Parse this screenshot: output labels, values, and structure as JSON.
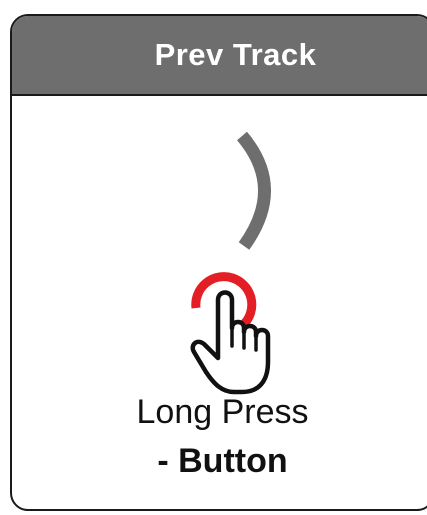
{
  "header": {
    "title": "Prev Track",
    "color": "#6e6e6e"
  },
  "gesture": {
    "arc_icon": "rotary-arc-icon",
    "touch_icon": "finger-press-icon",
    "press_ring_color": "#e31e24",
    "line1": "Long Press",
    "line2": "- Button"
  }
}
